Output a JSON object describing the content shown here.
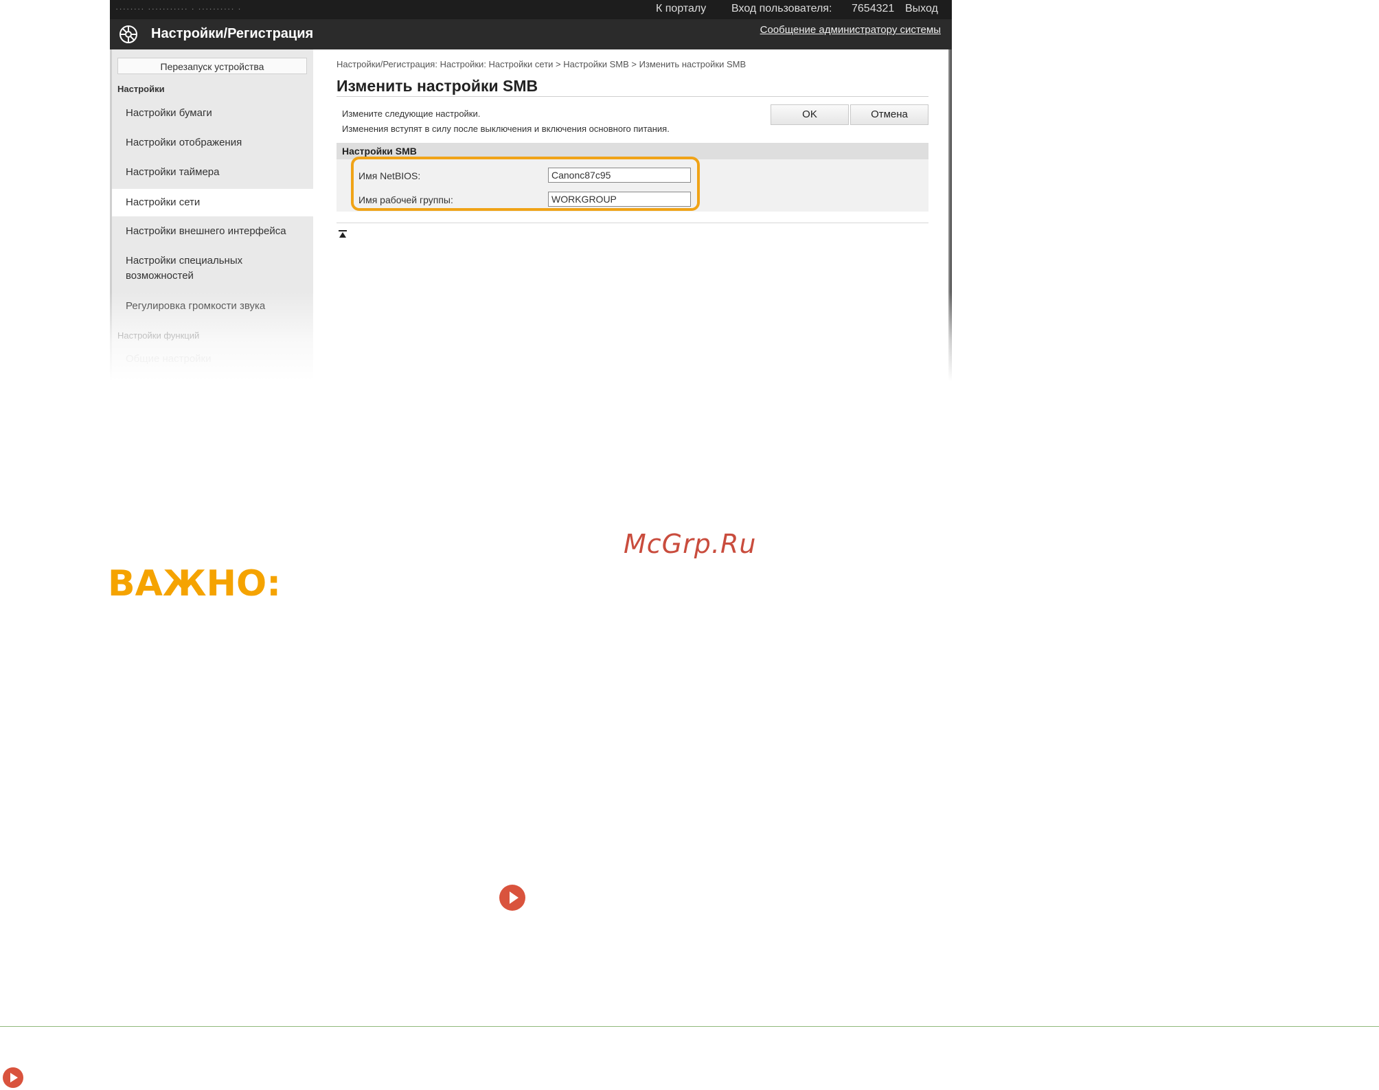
{
  "topbar": {
    "path_text": "········  ··········· · ·········· ·",
    "portal_link": "К порталу",
    "login_label": "Вход пользователя:",
    "login_id": "7654321",
    "logout_link": "Выход"
  },
  "header": {
    "title": "Настройки/Регистрация",
    "admin_message_link": "Сообщение администратору системы"
  },
  "sidebar": {
    "reboot_button": "Перезапуск устройства",
    "section_settings": "Настройки",
    "items": [
      {
        "label": "Настройки бумаги"
      },
      {
        "label": "Настройки отображения"
      },
      {
        "label": "Настройки таймера"
      },
      {
        "label": "Настройки сети"
      },
      {
        "label": "Настройки внешнего интерфейса"
      },
      {
        "label": "Настройки специальных возможностей"
      },
      {
        "label": "Регулировка громкости звука"
      }
    ],
    "active_index": 3,
    "section_functions": "Настройки функций",
    "functions_items": [
      {
        "label": "Общие настройки"
      }
    ]
  },
  "content": {
    "breadcrumb": "Настройки/Регистрация: Настройки: Настройки сети > Настройки SMB > Изменить настройки SMB",
    "page_title": "Изменить настройки SMB",
    "instruction_1": "Измените следующие настройки.",
    "instruction_2": "Изменения вступят в силу после выключения и включения основного питания.",
    "ok_button": "OK",
    "cancel_button": "Отмена",
    "smb_section_title": "Настройки SMB",
    "fields": {
      "netbios_label": "Имя NetBIOS:",
      "netbios_value": "Canonc87c95",
      "workgroup_label": "Имя рабочей группы:",
      "workgroup_value": "WORKGROUP"
    },
    "to_top_icon": "back-to-top-icon"
  },
  "document": {
    "watermark": "McGrp.Ru",
    "important_heading": "ВАЖНО:",
    "link_icon": "play-circle-icon"
  },
  "colors": {
    "highlight": "#f0a317",
    "important": "#f5a300",
    "link_icon": "#d9533d",
    "footer_rule": "#8fb97a"
  }
}
